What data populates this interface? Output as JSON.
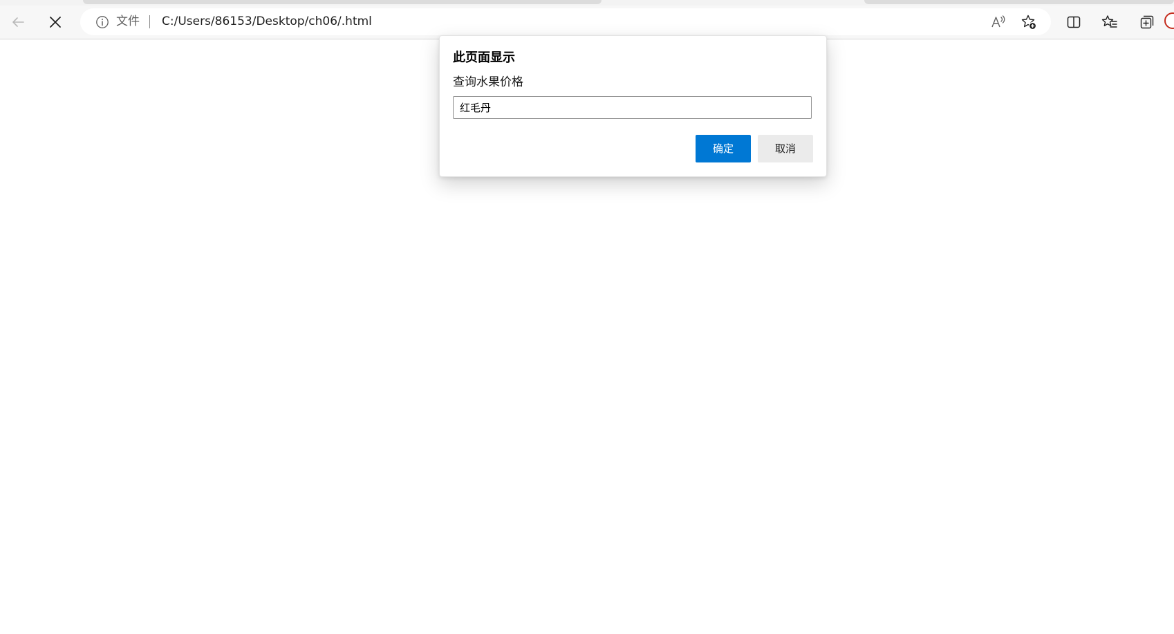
{
  "browser": {
    "address_bar": {
      "scheme_label": "文件",
      "url": "C:/Users/86153/Desktop/ch06/.html"
    },
    "icons": {
      "back": "back-arrow-icon",
      "stop": "close-icon",
      "info": "info-icon",
      "read_aloud": "read-aloud-icon",
      "add_favorite": "add-favorite-icon",
      "split_screen": "split-screen-icon",
      "favorites": "favorites-icon",
      "collections": "collections-icon",
      "profile": "profile-icon"
    }
  },
  "dialog": {
    "title": "此页面显示",
    "message": "查询水果价格",
    "input_value": "红毛丹",
    "ok_label": "确定",
    "cancel_label": "取消"
  },
  "colors": {
    "accent": "#0078d4",
    "cancel_bg": "#ebebeb",
    "toolbar_bg": "#f7f7f7"
  }
}
